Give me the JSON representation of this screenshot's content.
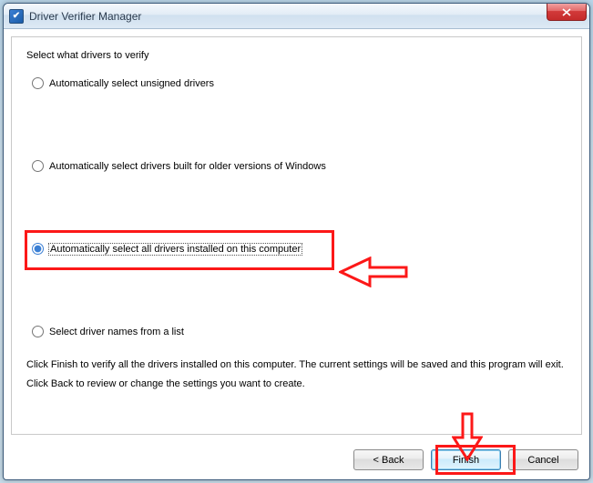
{
  "window": {
    "title": "Driver Verifier Manager"
  },
  "heading": "Select what drivers to verify",
  "options": {
    "opt1": "Automatically select unsigned drivers",
    "opt2": "Automatically select drivers built for older versions of Windows",
    "opt3": "Automatically select all drivers installed on this computer",
    "opt4": "Select driver names from a list"
  },
  "instructions": {
    "line1": "Click Finish to verify all the drivers installed on this computer. The current settings will be saved and this program will exit.",
    "line2": "Click Back to review or change the settings you want to create."
  },
  "buttons": {
    "back": "< Back",
    "finish": "Finish",
    "cancel": "Cancel"
  }
}
